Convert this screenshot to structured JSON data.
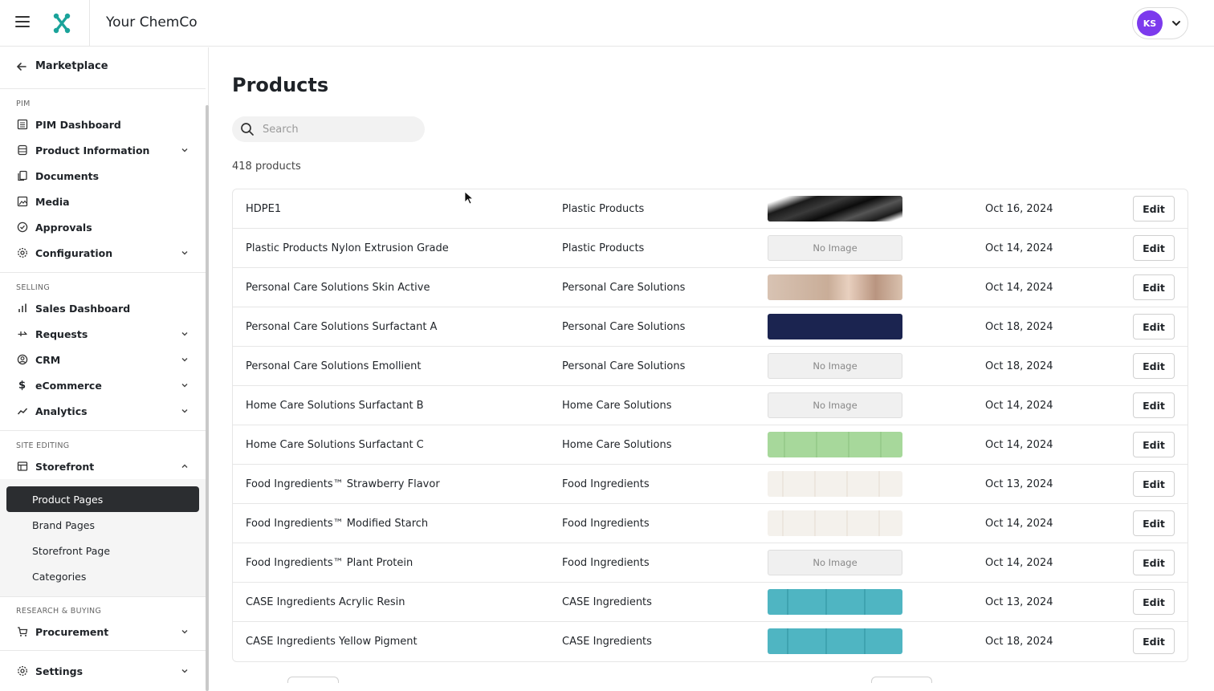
{
  "header": {
    "company_name": "Your ChemCo",
    "user_initials": "KS",
    "brand_color": "#1aa39a",
    "avatar_color": "#7c3aed"
  },
  "sidebar": {
    "back_label": "Marketplace",
    "sections": [
      {
        "label": "PIM",
        "items": [
          {
            "label": "PIM Dashboard",
            "icon": "dashboard-icon"
          },
          {
            "label": "Product Information",
            "icon": "database-icon",
            "expandable": true
          },
          {
            "label": "Documents",
            "icon": "documents-icon"
          },
          {
            "label": "Media",
            "icon": "media-icon"
          },
          {
            "label": "Approvals",
            "icon": "check-circle-icon"
          },
          {
            "label": "Configuration",
            "icon": "settings-icon",
            "expandable": true
          }
        ]
      },
      {
        "label": "SELLING",
        "items": [
          {
            "label": "Sales Dashboard",
            "icon": "bar-chart-icon"
          },
          {
            "label": "Requests",
            "icon": "requests-icon",
            "expandable": true
          },
          {
            "label": "CRM",
            "icon": "user-circle-icon",
            "expandable": true
          },
          {
            "label": "eCommerce",
            "icon": "dollar-icon",
            "expandable": true
          },
          {
            "label": "Analytics",
            "icon": "trend-icon",
            "expandable": true
          }
        ]
      },
      {
        "label": "SITE EDITING",
        "items": [
          {
            "label": "Storefront",
            "icon": "storefront-icon",
            "expanded": true,
            "children": [
              "Product Pages",
              "Brand Pages",
              "Storefront Page",
              "Categories"
            ],
            "active_child": "Product Pages"
          }
        ]
      },
      {
        "label": "RESEARCH & BUYING",
        "items": [
          {
            "label": "Procurement",
            "icon": "cart-icon",
            "expandable": true
          }
        ]
      }
    ],
    "settings_label": "Settings"
  },
  "main": {
    "title": "Products",
    "search_placeholder": "Search",
    "count_text": "418 products",
    "edit_label": "Edit",
    "no_image_label": "No Image",
    "rows": [
      {
        "name": "HDPE1",
        "category": "Plastic Products",
        "image": "black",
        "date": "Oct 16, 2024"
      },
      {
        "name": "Plastic Products Nylon Extrusion Grade",
        "category": "Plastic Products",
        "image": "none",
        "date": "Oct 14, 2024"
      },
      {
        "name": "Personal Care Solutions Skin Active",
        "category": "Personal Care Solutions",
        "image": "face",
        "date": "Oct 14, 2024"
      },
      {
        "name": "Personal Care Solutions Surfactant A",
        "category": "Personal Care Solutions",
        "image": "navy",
        "date": "Oct 18, 2024"
      },
      {
        "name": "Personal Care Solutions Emollient",
        "category": "Personal Care Solutions",
        "image": "none",
        "date": "Oct 18, 2024"
      },
      {
        "name": "Home Care Solutions Surfactant B",
        "category": "Home Care Solutions",
        "image": "none",
        "date": "Oct 14, 2024"
      },
      {
        "name": "Home Care Solutions Surfactant C",
        "category": "Home Care Solutions",
        "image": "green",
        "date": "Oct 14, 2024"
      },
      {
        "name": "Food Ingredients™ Strawberry Flavor",
        "category": "Food Ingredients",
        "image": "cream",
        "date": "Oct 13, 2024"
      },
      {
        "name": "Food Ingredients™ Modified Starch",
        "category": "Food Ingredients",
        "image": "cream",
        "date": "Oct 14, 2024"
      },
      {
        "name": "Food Ingredients™ Plant Protein",
        "category": "Food Ingredients",
        "image": "none",
        "date": "Oct 14, 2024"
      },
      {
        "name": "CASE Ingredients Acrylic Resin",
        "category": "CASE Ingredients",
        "image": "teal",
        "date": "Oct 13, 2024"
      },
      {
        "name": "CASE Ingredients Yellow Pigment",
        "category": "CASE Ingredients",
        "image": "teal",
        "date": "Oct 18, 2024"
      }
    ]
  }
}
